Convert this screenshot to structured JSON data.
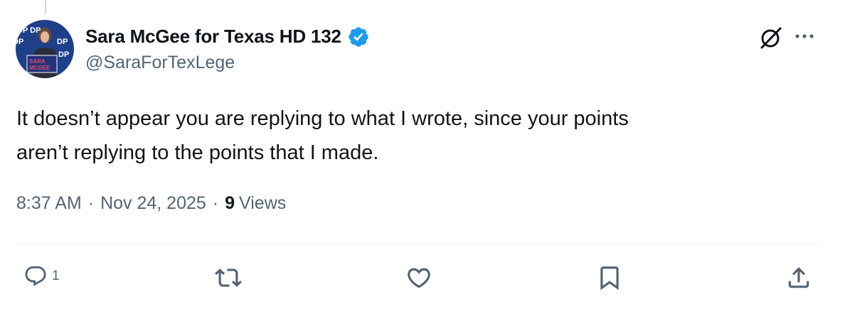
{
  "author": {
    "display_name": "Sara McGee for Texas HD 132",
    "handle": "@SaraForTexLege",
    "verified": true,
    "avatar_sign_text": "SARA MCGEE"
  },
  "tweet": {
    "text": "It doesn’t appear you are replying to what I wrote, since your points\naren’t replying to the points that I made."
  },
  "meta": {
    "time": "8:37 AM",
    "separator": "·",
    "date": "Nov 24, 2025",
    "views_count": "9",
    "views_label": "Views"
  },
  "actions": {
    "reply_count": "1",
    "icons": [
      "reply-icon",
      "retweet-icon",
      "like-icon",
      "bookmark-icon",
      "share-icon"
    ]
  },
  "colors": {
    "text_primary": "#0f1419",
    "text_secondary": "#536471",
    "verified_blue": "#1d9bf0",
    "divider": "#eff3f4"
  }
}
